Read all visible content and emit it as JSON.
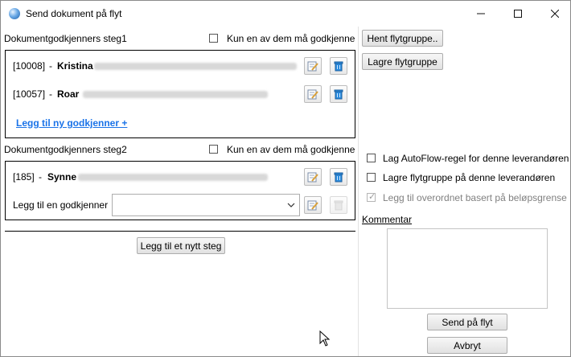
{
  "window": {
    "title": "Send dokument på flyt",
    "controls": {
      "minimize": "minimize",
      "maximize": "maximize",
      "close": "close"
    }
  },
  "step1": {
    "heading": "Dokumentgodkjenners steg1",
    "only_one_label": "Kun en av dem må godkjenne",
    "only_one_checked": false,
    "approvers": [
      {
        "id": "[10008]",
        "sep": "-",
        "name": "Kristina"
      },
      {
        "id": "[10057]",
        "sep": "-",
        "name": "Roar"
      }
    ],
    "add_link": "Legg til ny godkjenner +"
  },
  "step2": {
    "heading": "Dokumentgodkjenners steg2",
    "only_one_label": "Kun en av dem må godkjenne",
    "only_one_checked": false,
    "approvers": [
      {
        "id": "[185]",
        "sep": "-",
        "name": "Synne"
      }
    ],
    "add_label": "Legg til en godkjenner",
    "add_value": ""
  },
  "add_step_button": "Legg til et nytt steg",
  "right": {
    "fetch_group_button": "Hent flytgruppe..",
    "save_group_button": "Lagre flytgruppe",
    "options": [
      {
        "label": "Lag AutoFlow-regel for denne leverandøren",
        "checked": false,
        "disabled": false
      },
      {
        "label": "Lagre flytgruppe på denne leverandøren",
        "checked": false,
        "disabled": false
      },
      {
        "label": "Legg til overordnet basert på beløpsgrense",
        "checked": true,
        "disabled": true
      }
    ],
    "comment_label": "Kommentar",
    "comment_value": "",
    "send_button": "Send på flyt",
    "cancel_button": "Avbryt"
  }
}
